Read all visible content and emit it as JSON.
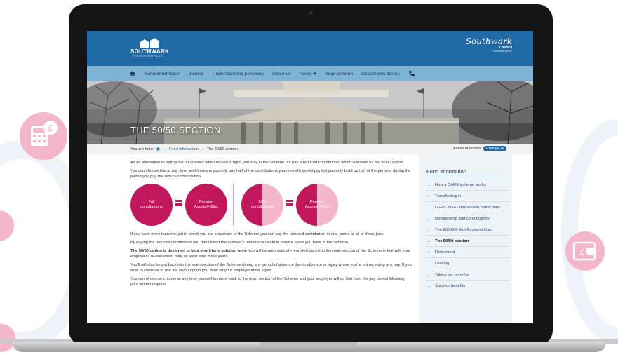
{
  "header": {
    "logo_text": "SOUTHWARK",
    "logo_sub": "PENSION SERVICES",
    "council_script": "Southwark",
    "council_word": "Council",
    "council_url": "southwark.gov.uk"
  },
  "nav": {
    "items": [
      "Fund information",
      "Joining",
      "Understanding pensions",
      "About us",
      "News ★",
      "Your pension",
      "Documents library"
    ]
  },
  "hero": {
    "title": "THE 50/50 SECTION"
  },
  "breadcrumb": {
    "prefix": "You are here:",
    "link": "Fund information",
    "current": "The 50/50 section",
    "member_label": "Active members",
    "change_label": "Change ➔"
  },
  "content": {
    "p1": "As an alternative to opting out, or at times when money is tight, you stay in the Scheme but pay a reduced contribution, which is known as the 50/50 option.",
    "p2": "You can choose this at any time, and it means you only pay half of the contributions you normally would pay but you only build up half of the pension during the period you pay the reduced contribution.",
    "circles": {
      "c1": "Full contributions",
      "c2_l1": "Pension",
      "c2_l2": "Accrual 49ths",
      "c3_l1": "50%",
      "c3_l2": "contributions",
      "c4_l1": "Pension",
      "c4_l2": "Accrual 98ths"
    },
    "p3": "If you have more than one job in which you are a member of the Scheme you can pay the reduced contribution in one, some or all of those jobs.",
    "p4": "By paying the reduced contribution you don't affect the survivor's benefits or death in service cover you have in the Scheme.",
    "p5_bold": "The 50/50 option is designed to be a short-term solution only.",
    "p5_rest": " You will be automatically- enrolled back into the main section of the Scheme in line with your employer's re-enrolment date, at least after three years.",
    "p6": "You'll will also be put back into the main section of the Scheme during any period of absence due to absence or injury where you're not receiving any pay. If you wish to continue to use the 50/50 option you must let your employer know again.",
    "p7": "You can of course choose at any time yourself to move back to the main section of the Scheme and your employer will do that from the pay period following your written request."
  },
  "sidebar": {
    "title": "Fund information",
    "items": [
      "How a CARE scheme works",
      "Transferring in",
      "LGPS 2014 - transitional protections",
      "Membership and contributions",
      "The £95,000 Exit Payment Cap",
      "The 50/50 section",
      "Retirement",
      "Leaving",
      "Taking my benefits",
      "Survivor benefits"
    ]
  },
  "colors": {
    "header_blue": "#1f6aa5",
    "nav_blue": "#7fb3d5",
    "accent_pink": "#c2185b",
    "deco_pink": "#f5c6d6"
  }
}
